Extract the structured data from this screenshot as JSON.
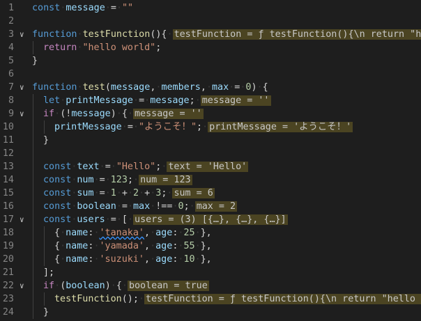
{
  "editor": {
    "language": "javascript",
    "lines": [
      {
        "num": "1",
        "fold": false,
        "guides": 0,
        "tokens": [
          [
            "kw",
            "const"
          ],
          [
            "ws",
            "·"
          ],
          [
            "var",
            "message"
          ],
          [
            "ws",
            "·"
          ],
          [
            "op",
            "="
          ],
          [
            "ws",
            "·"
          ],
          [
            "str",
            "\"\""
          ]
        ]
      },
      {
        "num": "2",
        "fold": false,
        "guides": 0,
        "tokens": []
      },
      {
        "num": "3",
        "fold": true,
        "guides": 0,
        "tokens": [
          [
            "kw",
            "function"
          ],
          [
            "ws",
            "·"
          ],
          [
            "fn",
            "testFunction"
          ],
          [
            "op",
            "(){"
          ],
          [
            "ws",
            "·"
          ]
        ],
        "inline": "testFunction = ƒ testFunction(){\\n return \"hello"
      },
      {
        "num": "4",
        "fold": false,
        "guides": 1,
        "tokens": [
          [
            "ctl",
            "return"
          ],
          [
            "ws",
            "·"
          ],
          [
            "str",
            "\"hello world\""
          ],
          [
            "op",
            ";"
          ]
        ]
      },
      {
        "num": "5",
        "fold": false,
        "guides": 0,
        "tokens": [
          [
            "op",
            "}"
          ]
        ]
      },
      {
        "num": "6",
        "fold": false,
        "guides": 0,
        "tokens": []
      },
      {
        "num": "7",
        "fold": true,
        "guides": 0,
        "tokens": [
          [
            "kw",
            "function"
          ],
          [
            "ws",
            "·"
          ],
          [
            "fn",
            "test"
          ],
          [
            "op",
            "("
          ],
          [
            "var",
            "message"
          ],
          [
            "op",
            ","
          ],
          [
            "ws",
            "·"
          ],
          [
            "var",
            "members"
          ],
          [
            "op",
            ","
          ],
          [
            "ws",
            "·"
          ],
          [
            "var",
            "max"
          ],
          [
            "ws",
            "·"
          ],
          [
            "op",
            "="
          ],
          [
            "ws",
            "·"
          ],
          [
            "num",
            "0"
          ],
          [
            "op",
            ")"
          ],
          [
            "ws",
            "·"
          ],
          [
            "op",
            "{"
          ]
        ]
      },
      {
        "num": "8",
        "fold": false,
        "guides": 1,
        "tokens": [
          [
            "kw",
            "let"
          ],
          [
            "ws",
            "·"
          ],
          [
            "var",
            "printMessage"
          ],
          [
            "ws",
            "·"
          ],
          [
            "op",
            "="
          ],
          [
            "ws",
            "·"
          ],
          [
            "var",
            "message"
          ],
          [
            "op",
            ";"
          ],
          [
            "ws",
            "·"
          ]
        ],
        "inline": "message = ''"
      },
      {
        "num": "9",
        "fold": true,
        "guides": 1,
        "tokens": [
          [
            "ctl",
            "if"
          ],
          [
            "ws",
            "·"
          ],
          [
            "op",
            "(!"
          ],
          [
            "var",
            "message"
          ],
          [
            "op",
            ")"
          ],
          [
            "ws",
            "·"
          ],
          [
            "op",
            "{"
          ],
          [
            "ws",
            "·"
          ]
        ],
        "inline": "message = ''"
      },
      {
        "num": "10",
        "fold": false,
        "guides": 2,
        "tokens": [
          [
            "var",
            "printMessage"
          ],
          [
            "ws",
            "·"
          ],
          [
            "op",
            "="
          ],
          [
            "ws",
            "·"
          ],
          [
            "str",
            "\"ようこそ！\""
          ],
          [
            "op",
            ";"
          ],
          [
            "ws",
            "·"
          ]
        ],
        "inline": "printMessage = 'ようこそ！'"
      },
      {
        "num": "11",
        "fold": false,
        "guides": 1,
        "tokens": [
          [
            "op",
            "}"
          ]
        ]
      },
      {
        "num": "12",
        "fold": false,
        "guides": 1,
        "tokens": []
      },
      {
        "num": "13",
        "fold": false,
        "guides": 1,
        "tokens": [
          [
            "kw",
            "const"
          ],
          [
            "ws",
            "·"
          ],
          [
            "var",
            "text"
          ],
          [
            "ws",
            "·"
          ],
          [
            "op",
            "="
          ],
          [
            "ws",
            "·"
          ],
          [
            "str",
            "\"Hello\""
          ],
          [
            "op",
            ";"
          ],
          [
            "ws",
            "·"
          ]
        ],
        "inline": "text = 'Hello'"
      },
      {
        "num": "14",
        "fold": false,
        "guides": 1,
        "tokens": [
          [
            "kw",
            "const"
          ],
          [
            "ws",
            "·"
          ],
          [
            "var",
            "num"
          ],
          [
            "ws",
            "·"
          ],
          [
            "op",
            "="
          ],
          [
            "ws",
            "·"
          ],
          [
            "num",
            "123"
          ],
          [
            "op",
            ";"
          ],
          [
            "ws",
            "·"
          ]
        ],
        "inline": "num = 123"
      },
      {
        "num": "15",
        "fold": false,
        "guides": 1,
        "tokens": [
          [
            "kw",
            "const"
          ],
          [
            "ws",
            "·"
          ],
          [
            "var",
            "sum"
          ],
          [
            "ws",
            "·"
          ],
          [
            "op",
            "="
          ],
          [
            "ws",
            "·"
          ],
          [
            "num",
            "1"
          ],
          [
            "ws",
            "·"
          ],
          [
            "op",
            "+"
          ],
          [
            "ws",
            "·"
          ],
          [
            "num",
            "2"
          ],
          [
            "ws",
            "·"
          ],
          [
            "op",
            "+"
          ],
          [
            "ws",
            "·"
          ],
          [
            "num",
            "3"
          ],
          [
            "op",
            ";"
          ],
          [
            "ws",
            "·"
          ]
        ],
        "inline": "sum = 6"
      },
      {
        "num": "16",
        "fold": false,
        "guides": 1,
        "tokens": [
          [
            "kw",
            "const"
          ],
          [
            "ws",
            "·"
          ],
          [
            "var",
            "boolean"
          ],
          [
            "ws",
            "·"
          ],
          [
            "op",
            "="
          ],
          [
            "ws",
            "·"
          ],
          [
            "var",
            "max"
          ],
          [
            "ws",
            "·"
          ],
          [
            "op",
            "!=="
          ],
          [
            "ws",
            "·"
          ],
          [
            "num",
            "0"
          ],
          [
            "op",
            ";"
          ],
          [
            "ws",
            "·"
          ]
        ],
        "inline": "max = 2"
      },
      {
        "num": "17",
        "fold": true,
        "guides": 1,
        "tokens": [
          [
            "kw",
            "const"
          ],
          [
            "ws",
            "·"
          ],
          [
            "var",
            "users"
          ],
          [
            "ws",
            "·"
          ],
          [
            "op",
            "="
          ],
          [
            "ws",
            "·"
          ],
          [
            "op",
            "["
          ],
          [
            "ws",
            "·"
          ]
        ],
        "inline": "users = (3) [{…}, {…}, {…}]"
      },
      {
        "num": "18",
        "fold": false,
        "guides": 2,
        "tokens": [
          [
            "op",
            "{"
          ],
          [
            "ws",
            "·"
          ],
          [
            "var",
            "name"
          ],
          [
            "op",
            ":"
          ],
          [
            "ws",
            "·"
          ],
          [
            "str",
            "'tanaka'",
            "squiggle"
          ],
          [
            "op",
            ","
          ],
          [
            "ws",
            "·"
          ],
          [
            "var",
            "age"
          ],
          [
            "op",
            ":"
          ],
          [
            "ws",
            "·"
          ],
          [
            "num",
            "25"
          ],
          [
            "ws",
            "·"
          ],
          [
            "op",
            "},"
          ]
        ]
      },
      {
        "num": "19",
        "fold": false,
        "guides": 2,
        "tokens": [
          [
            "op",
            "{"
          ],
          [
            "ws",
            "·"
          ],
          [
            "var",
            "name"
          ],
          [
            "op",
            ":"
          ],
          [
            "ws",
            "·"
          ],
          [
            "str",
            "'yamada'"
          ],
          [
            "op",
            ","
          ],
          [
            "ws",
            "·"
          ],
          [
            "var",
            "age"
          ],
          [
            "op",
            ":"
          ],
          [
            "ws",
            "·"
          ],
          [
            "num",
            "55"
          ],
          [
            "ws",
            "·"
          ],
          [
            "op",
            "},"
          ]
        ]
      },
      {
        "num": "20",
        "fold": false,
        "guides": 2,
        "tokens": [
          [
            "op",
            "{"
          ],
          [
            "ws",
            "·"
          ],
          [
            "var",
            "name"
          ],
          [
            "op",
            ":"
          ],
          [
            "ws",
            "·"
          ],
          [
            "str",
            "'suzuki'"
          ],
          [
            "op",
            ","
          ],
          [
            "ws",
            "·"
          ],
          [
            "var",
            "age"
          ],
          [
            "op",
            ":"
          ],
          [
            "ws",
            "·"
          ],
          [
            "num",
            "10"
          ],
          [
            "ws",
            "·"
          ],
          [
            "op",
            "},"
          ]
        ]
      },
      {
        "num": "21",
        "fold": false,
        "guides": 1,
        "tokens": [
          [
            "op",
            "];"
          ]
        ]
      },
      {
        "num": "22",
        "fold": true,
        "guides": 1,
        "tokens": [
          [
            "ctl",
            "if"
          ],
          [
            "ws",
            "·"
          ],
          [
            "op",
            "("
          ],
          [
            "var",
            "boolean"
          ],
          [
            "op",
            ")"
          ],
          [
            "ws",
            "·"
          ],
          [
            "op",
            "{"
          ],
          [
            "ws",
            "·"
          ]
        ],
        "inline": "boolean = true"
      },
      {
        "num": "23",
        "fold": false,
        "guides": 2,
        "tokens": [
          [
            "fn",
            "testFunction"
          ],
          [
            "op",
            "();"
          ],
          [
            "ws",
            "·"
          ]
        ],
        "inline": "testFunction = ƒ testFunction(){\\n return \"hello wor"
      },
      {
        "num": "24",
        "fold": false,
        "guides": 1,
        "tokens": [
          [
            "op",
            "}"
          ]
        ]
      }
    ]
  }
}
